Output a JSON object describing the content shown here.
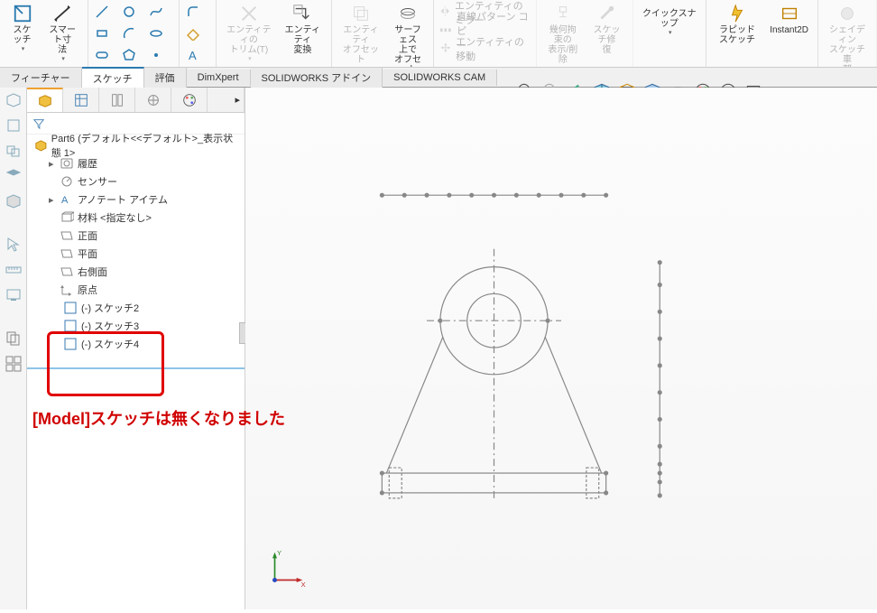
{
  "ribbon": {
    "sketch": "スケッチ",
    "smart_dim": "スマート寸\n法",
    "trim": "エンティティの\nトリム(T)",
    "entity_convert": "エンティティ\n変換",
    "entity_offset": "エンティティ\nオフセット",
    "surface_offset": "サーフェス\n上で\nオフセット",
    "mirror": "エンティティのミラー",
    "linear_pattern": "直線パターン コピ\nー",
    "move_entities": "エンティティの移動",
    "geom_rel": "幾何拘束の\n表示/削除",
    "sketch_repair": "スケッチ修\n復",
    "quick_snap": "クイックスナップ",
    "rapid_sketch": "ラピッドスケッチ",
    "instant2d": "Instant2D",
    "shaded_sketch": "シェイディン\nスケッチ車\n郭"
  },
  "tabs": {
    "feature": "フィーチャー",
    "sketch": "スケッチ",
    "evaluate": "評価",
    "dimxpert": "DimXpert",
    "sw_addin": "SOLIDWORKS アドイン",
    "sw_cam": "SOLIDWORKS CAM"
  },
  "tree": {
    "root": "Part6 (デフォルト<<デフォルト>_表示状態 1>",
    "history": "履歴",
    "sensors": "センサー",
    "annotations": "アノテート アイテム",
    "material": "材料 <指定なし>",
    "front": "正面",
    "plane": "平面",
    "right": "右側面",
    "origin": "原点",
    "sketch2": "(-) スケッチ2",
    "sketch3": "(-) スケッチ3",
    "sketch4": "(-) スケッチ4"
  },
  "annotation_text": "[Model]スケッチは無くなりました",
  "triad": {
    "x": "X",
    "y": "Y"
  }
}
